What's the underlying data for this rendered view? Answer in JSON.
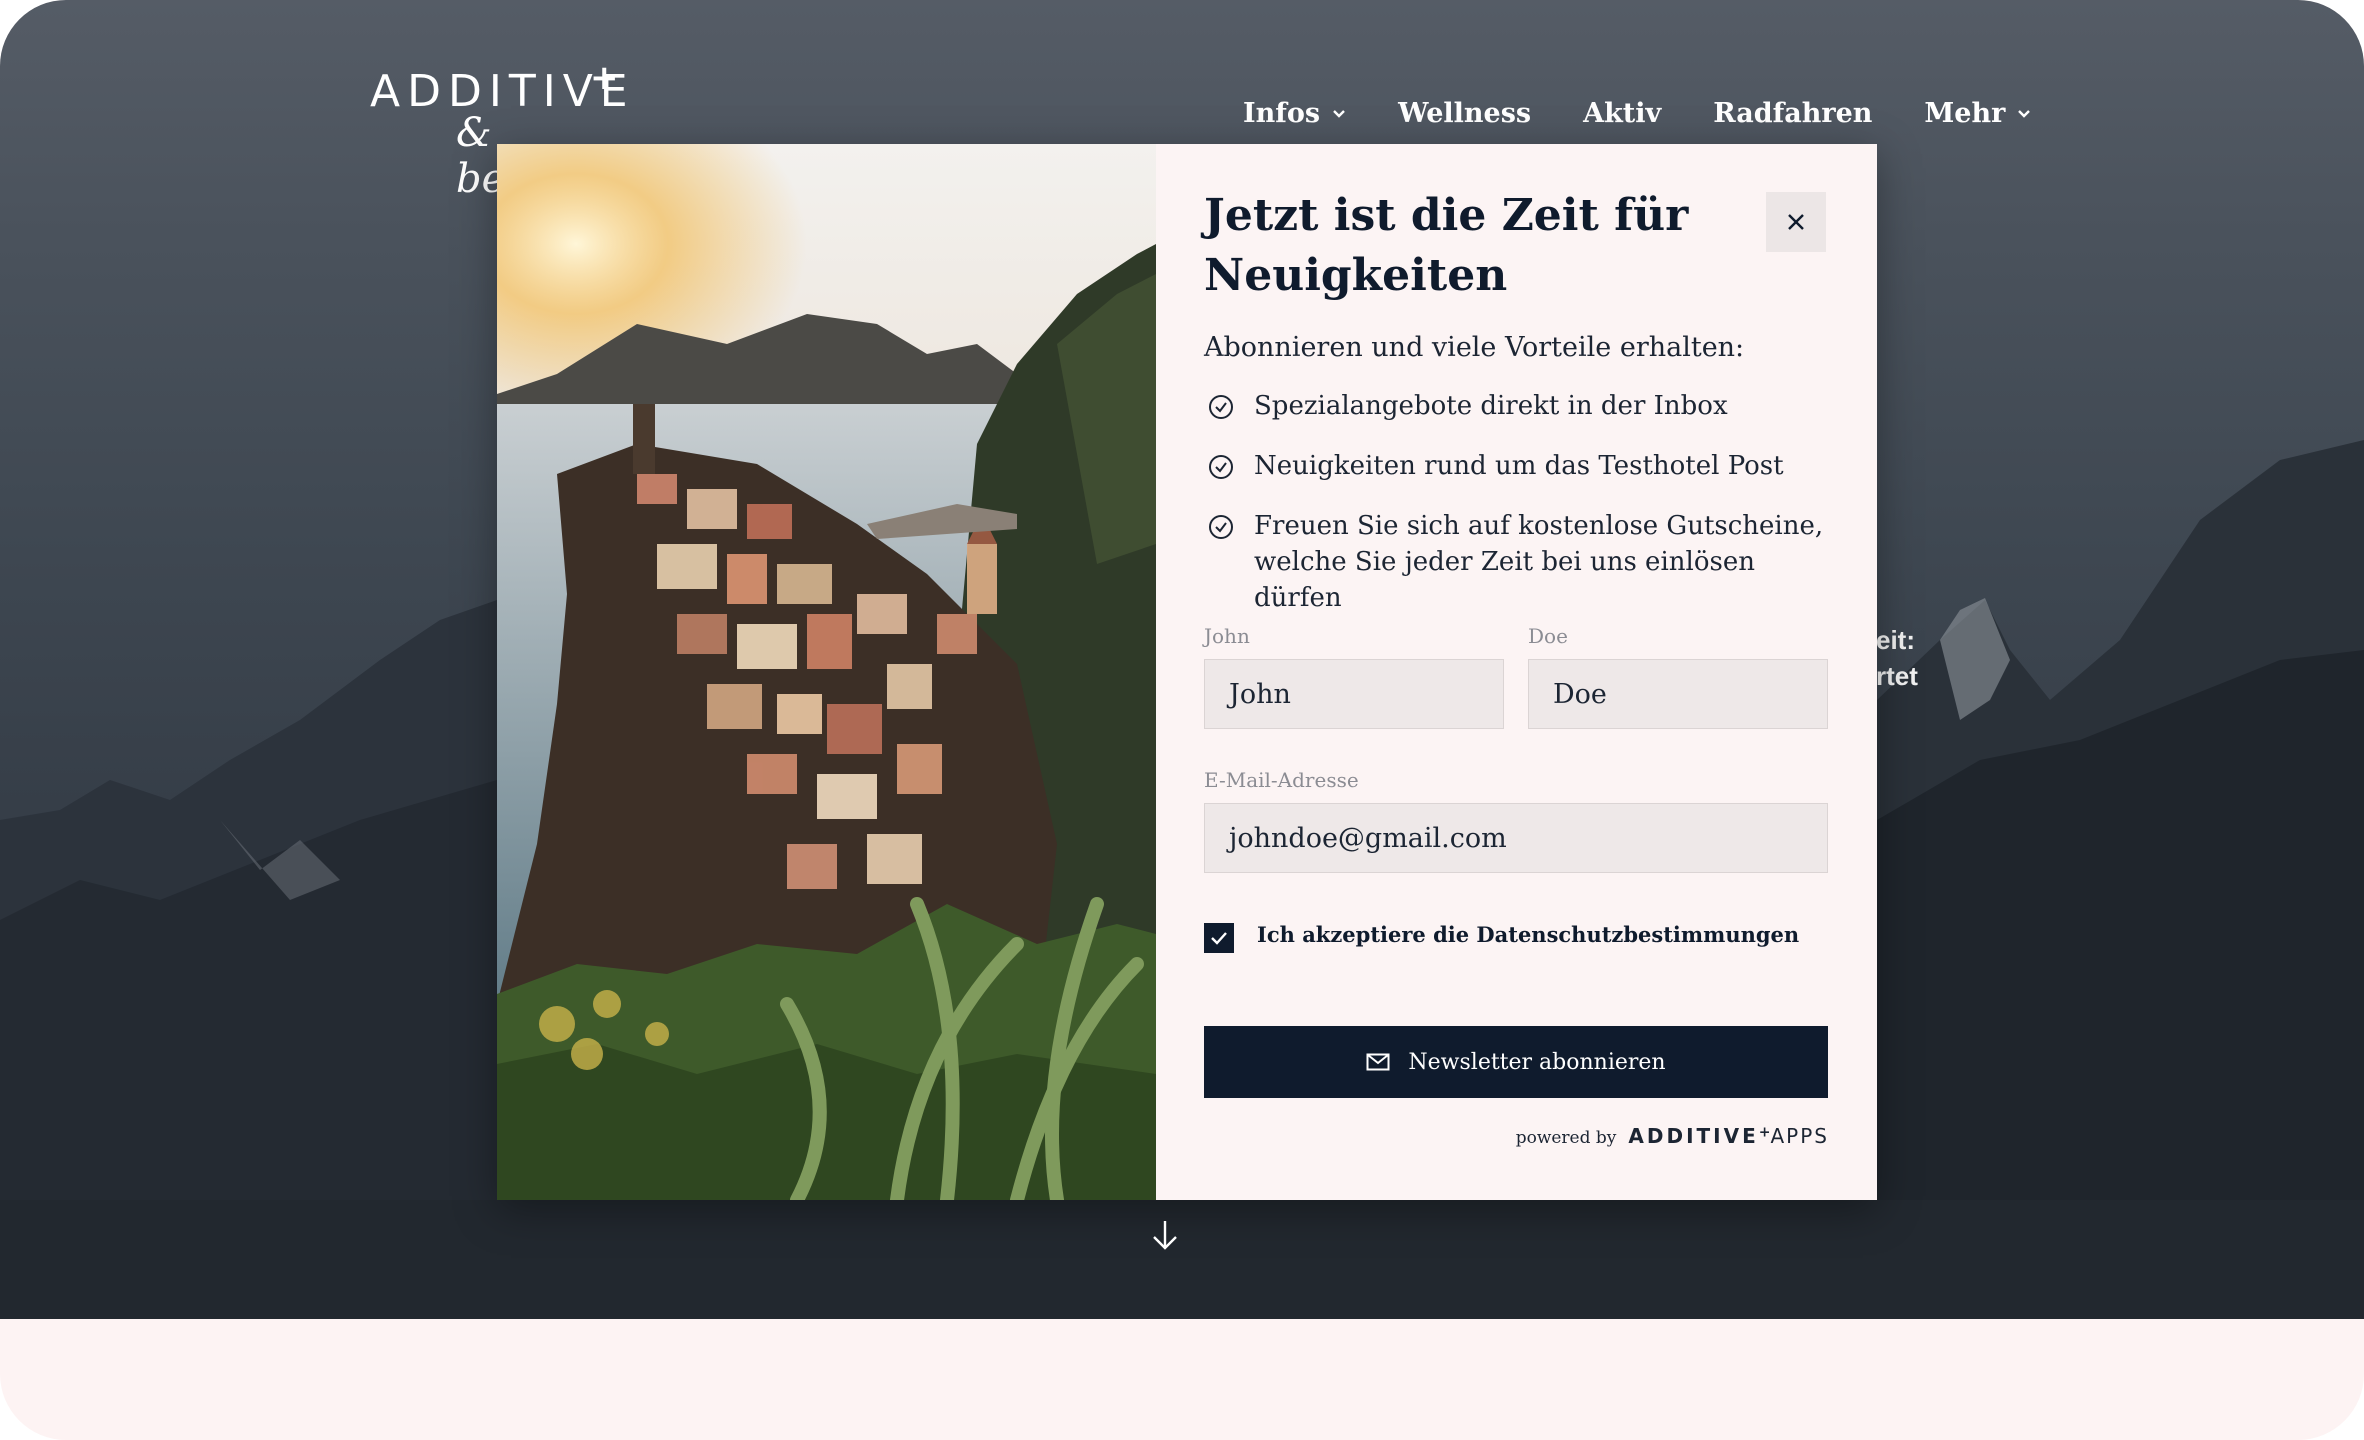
{
  "brand": {
    "logo_word": "ADDITIVE",
    "logo_plus": "+",
    "logo_script": "& beyond"
  },
  "nav": {
    "items": [
      {
        "label": "Infos",
        "has_dropdown": true
      },
      {
        "label": "Wellness",
        "has_dropdown": false
      },
      {
        "label": "Aktiv",
        "has_dropdown": false
      },
      {
        "label": "Radfahren",
        "has_dropdown": false
      },
      {
        "label": "Mehr",
        "has_dropdown": true
      }
    ]
  },
  "hero": {
    "partial_text_line1": "eit:",
    "partial_text_line2": "rtet"
  },
  "modal": {
    "title": "Jetzt ist die Zeit für Neuigkeiten",
    "close_icon": "close-icon",
    "subtitle": "Abonnieren und viele Vorteile erhalten:",
    "benefits": [
      "Spezialangebote direkt in der Inbox",
      "Neuigkeiten rund um das Testhotel Post",
      "Freuen Sie sich auf kostenlose Gutscheine, welche Sie jeder Zeit bei uns einlösen dürfen"
    ],
    "form": {
      "first_name_label": "John",
      "first_name_value": "John",
      "last_name_label": "Doe",
      "last_name_value": "Doe",
      "email_label": "E-Mail-Adresse",
      "email_value": "johndoe@gmail.com",
      "consent_label": "Ich akzeptiere die Datenschutzbestimmungen",
      "consent_checked": true,
      "submit_label": "Newsletter abonnieren",
      "submit_icon": "mail-icon"
    },
    "powered_by": "powered by",
    "powered_brand": "ADDITIVE",
    "powered_plus": "+",
    "powered_apps": "APPS"
  },
  "colors": {
    "navy": "#0f1b2d",
    "panel_bg": "#fcf4f4",
    "field_bg": "#eee8e8",
    "footer_bg": "#fdf3f3"
  }
}
